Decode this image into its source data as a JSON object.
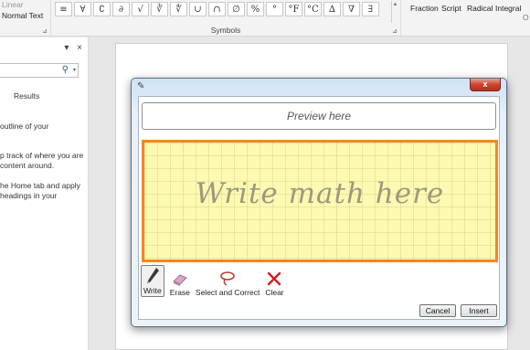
{
  "ribbon": {
    "tools": {
      "linear_label": "Linear",
      "normal_text_label": "Normal Text",
      "launcher": "⊿"
    },
    "symbols": {
      "items": [
        "≡",
        "∀",
        "∁",
        "∂",
        "√",
        "∛",
        "∜",
        "∪",
        "∩",
        "∅",
        "%",
        "°",
        "°F",
        "°C",
        "∆",
        "∇",
        "∃",
        "∄"
      ],
      "scroll_glyph": "▲",
      "group_label": "Symbols",
      "launcher": "⊿"
    },
    "structures": {
      "fraction": "Fraction",
      "script": "Script",
      "radical": "Radical",
      "integral": "Integral",
      "overflow": "O"
    }
  },
  "nav": {
    "pin": "▾",
    "close": "×",
    "search_icon": "⚲",
    "search_dropdown": "▾",
    "results_tab": "Results",
    "lines": [
      "outline of your",
      "",
      "p track of where you are",
      "content around.",
      "he Home tab and apply",
      "headings in your"
    ]
  },
  "dialog": {
    "title_icon": "✎",
    "close_label": "x",
    "preview_placeholder": "Preview here",
    "write_hint": "Write math here",
    "tools": [
      {
        "label": "Write",
        "icon": "pen-icon",
        "active": true
      },
      {
        "label": "Erase",
        "icon": "eraser-icon",
        "active": false
      },
      {
        "label": "Select and Correct",
        "icon": "lasso-icon",
        "active": false
      },
      {
        "label": "Clear",
        "icon": "clear-icon",
        "active": false
      }
    ],
    "cancel_label": "Cancel",
    "insert_label": "Insert"
  },
  "colors": {
    "accent_border": "#f5861f",
    "pad_background": "#fdf9b0",
    "close_red": "#c8402a"
  }
}
